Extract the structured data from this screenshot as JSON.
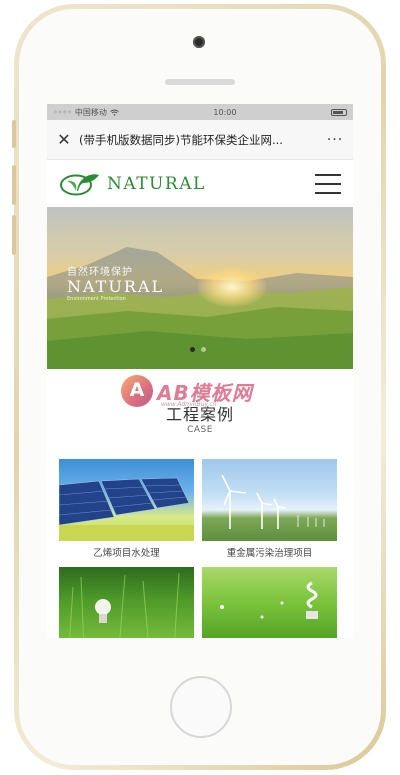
{
  "statusbar": {
    "carrier": "中国移动",
    "wifi_icon": "wifi-icon",
    "time": "10:00",
    "battery_icon": "battery-icon"
  },
  "browser": {
    "close_icon": "close-icon",
    "title": "(带手机版数据同步)节能环保类企业网...",
    "more": "···"
  },
  "header": {
    "logo_text": "NATURAL",
    "menu_icon": "hamburger-menu-icon"
  },
  "banner": {
    "cn_text": "自然环境保护",
    "en_text": "NATURAL",
    "sub_text": "Environment Protection",
    "slides": [
      {
        "active": true
      },
      {
        "active": false
      }
    ]
  },
  "section": {
    "title": "工程案例",
    "subtitle": "CASE",
    "watermark": {
      "text": "AB模板网",
      "small": "www.AdminBuy.cn"
    }
  },
  "cases": [
    {
      "label": "乙烯项目水处理",
      "image": "solar-panels"
    },
    {
      "label": "重金属污染治理项目",
      "image": "wind-turbines"
    },
    {
      "label": "",
      "image": "light-bulb-grass"
    },
    {
      "label": "",
      "image": "eco-bulb-grass"
    }
  ],
  "colors": {
    "brand_green": "#2e8b35",
    "phone_gold": "#e2d4ad"
  }
}
